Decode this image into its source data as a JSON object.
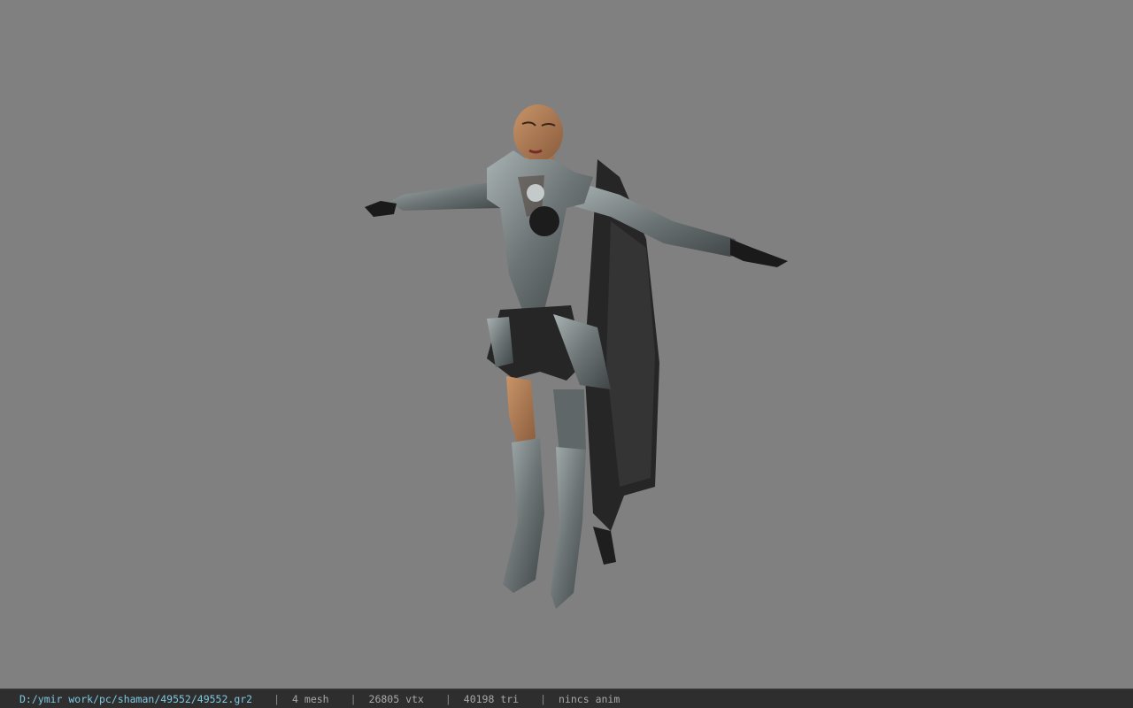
{
  "viewport": {
    "background_color": "#808080",
    "subject": "character-model-3d"
  },
  "status_bar": {
    "file_path": "D:/ymir work/pc/shaman/49552/49552.gr2",
    "separator": "|",
    "mesh_count": "4 mesh",
    "vertex_count": "26805 vtx",
    "triangle_count": "40198 tri",
    "animation": "nincs anim",
    "path_color": "#7fc8e0"
  }
}
